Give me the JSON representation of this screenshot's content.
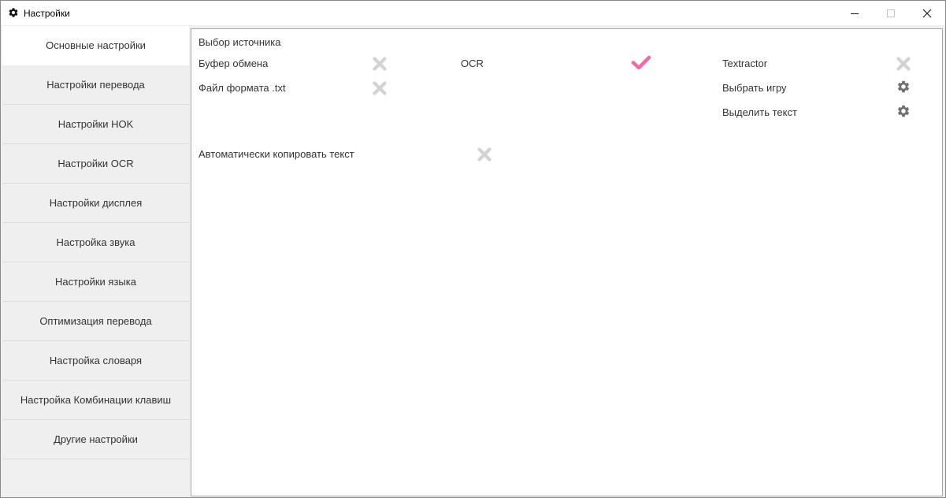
{
  "window": {
    "title": "Настройки",
    "icon": "gear-icon",
    "controls": [
      "minimize-icon",
      "maximize-icon",
      "close-icon"
    ]
  },
  "sidebar": {
    "items": [
      {
        "label": "Основные настройки",
        "active": true
      },
      {
        "label": "Настройки перевода"
      },
      {
        "label": "Настройки HOK"
      },
      {
        "label": "Настройки OCR"
      },
      {
        "label": "Настройки дисплея"
      },
      {
        "label": "Настройка звука"
      },
      {
        "label": "Настройки языка"
      },
      {
        "label": "Оптимизация перевода"
      },
      {
        "label": "Настройка словаря"
      },
      {
        "label": "Настройка Комбинации клавиш"
      },
      {
        "label": "Другие настройки"
      }
    ]
  },
  "main": {
    "section_title": "Выбор источника",
    "sources": {
      "clipboard": {
        "label": "Буфер обмена",
        "state": "off",
        "icon": "x-icon"
      },
      "txt_file": {
        "label": "Файл формата .txt",
        "state": "off",
        "icon": "x-icon"
      },
      "ocr": {
        "label": "OCR",
        "state": "on",
        "icon": "check-icon"
      },
      "textractor": {
        "label": "Textractor",
        "state": "off",
        "icon": "x-icon"
      },
      "select_game": {
        "label": "Выбрать игру",
        "icon": "gear-icon"
      },
      "select_text": {
        "label": "Выделить текст",
        "icon": "gear-icon"
      }
    },
    "auto_copy": {
      "label": "Автоматически копировать текст",
      "state": "off",
      "icon": "x-icon"
    }
  },
  "colors": {
    "accent_check": "#f06aaa",
    "toggle_off": "#d3d3d3",
    "gear": "#707070",
    "window_bg": "#f0f0f0",
    "content_bg": "#ffffff"
  }
}
